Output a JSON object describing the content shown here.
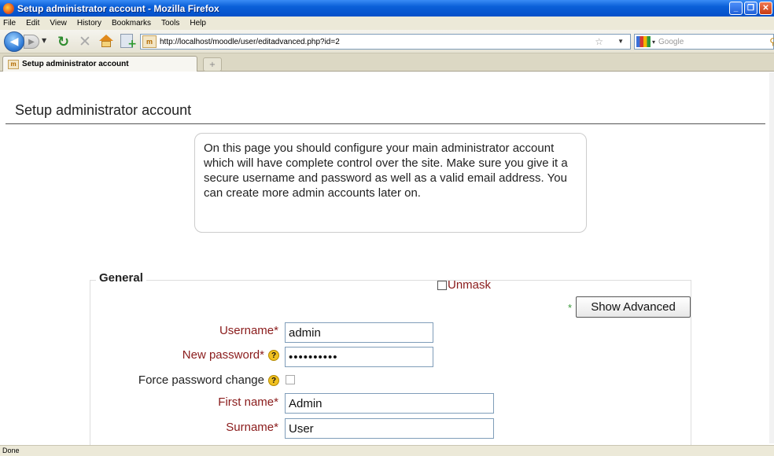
{
  "window": {
    "title": "Setup administrator account - Mozilla Firefox"
  },
  "menu": {
    "items": [
      "File",
      "Edit",
      "View",
      "History",
      "Bookmarks",
      "Tools",
      "Help"
    ]
  },
  "navbar": {
    "url": "http://localhost/moodle/user/editadvanced.php?id=2",
    "search_placeholder": "Google"
  },
  "tab": {
    "label": "Setup administrator account",
    "site_icon_text": "m"
  },
  "page": {
    "title": "Setup administrator account",
    "notice": "On this page you should configure your main administrator account which will have complete control over the site. Make sure you give it a secure username and password as well as a valid email address. You can create more admin accounts later on."
  },
  "form": {
    "legend": "General",
    "required_marker": "*",
    "show_advanced_label": "Show Advanced",
    "username_label": "Username",
    "username_value": "admin",
    "password_label": "New password",
    "password_value": "••••••••••",
    "unmask_label": "Unmask",
    "force_change_label": "Force password change",
    "firstname_label": "First name",
    "firstname_value": "Admin",
    "surname_label": "Surname",
    "surname_value": "User",
    "help_symbol": "?"
  },
  "status": {
    "text": "Done"
  }
}
